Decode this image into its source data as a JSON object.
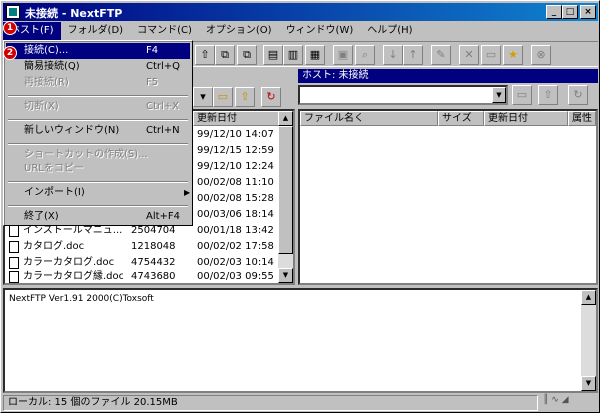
{
  "window": {
    "title": "未接続 - NextFTP"
  },
  "window_buttons": {
    "minimize": "_",
    "maximize": "□",
    "close": "×"
  },
  "menubar": [
    {
      "label": "ホスト(F)"
    },
    {
      "label": "フォルダ(D)"
    },
    {
      "label": "コマンド(C)"
    },
    {
      "label": "オプション(O)"
    },
    {
      "label": "ウィンドウ(W)"
    },
    {
      "label": "ヘルプ(H)"
    }
  ],
  "dropdown": {
    "items": [
      {
        "label": "接続(C)...",
        "shortcut": "F4"
      },
      {
        "label": "簡易接続(Q)",
        "shortcut": "Ctrl+Q"
      },
      {
        "label": "再接続(R)",
        "shortcut": "F5"
      },
      {
        "label": "切断(X)",
        "shortcut": "Ctrl+X"
      },
      {
        "label": "新しいウィンドウ(N)",
        "shortcut": "Ctrl+N"
      },
      {
        "label": "ショートカットの作成(S)..."
      },
      {
        "label": "URLをコピー"
      },
      {
        "label": "インポート(I)"
      },
      {
        "label": "終了(X)",
        "shortcut": "Alt+F4"
      }
    ]
  },
  "badges": {
    "one": "1",
    "two": "2"
  },
  "left_pane": {
    "col_date": "更新日付",
    "rows": [
      {
        "name": "",
        "size": "",
        "date": "99/12/10 14:07"
      },
      {
        "name": "",
        "size": "",
        "date": "99/12/15 12:59"
      },
      {
        "name": "",
        "size": "",
        "date": "99/12/10 12:24"
      },
      {
        "name": "",
        "size": "",
        "date": "00/02/08 11:10"
      },
      {
        "name": "",
        "size": "",
        "date": "00/02/08 15:28"
      },
      {
        "name": "",
        "size": "",
        "date": "00/03/06 18:14"
      },
      {
        "name": "インストールマニュ...",
        "size": "2504704",
        "date": "00/01/18 13:42"
      },
      {
        "name": "カタログ.doc",
        "size": "1218048",
        "date": "00/02/02 17:58"
      },
      {
        "name": "カラーカタログ.doc",
        "size": "4754432",
        "date": "00/02/03 10:14"
      },
      {
        "name": "カラーカタログ縁.doc",
        "size": "4743680",
        "date": "00/02/03 09:55"
      }
    ]
  },
  "right_pane": {
    "host_label": "ホスト: 未接続",
    "col_name": "ファイル名く",
    "col_size": "サイズ",
    "col_date": "更新日付",
    "col_attr": "属性"
  },
  "log": {
    "text": "NextFTP Ver1.91 2000(C)Toxsoft"
  },
  "statusbar": {
    "text": "ローカル: 15 個のファイル 20.15MB"
  }
}
